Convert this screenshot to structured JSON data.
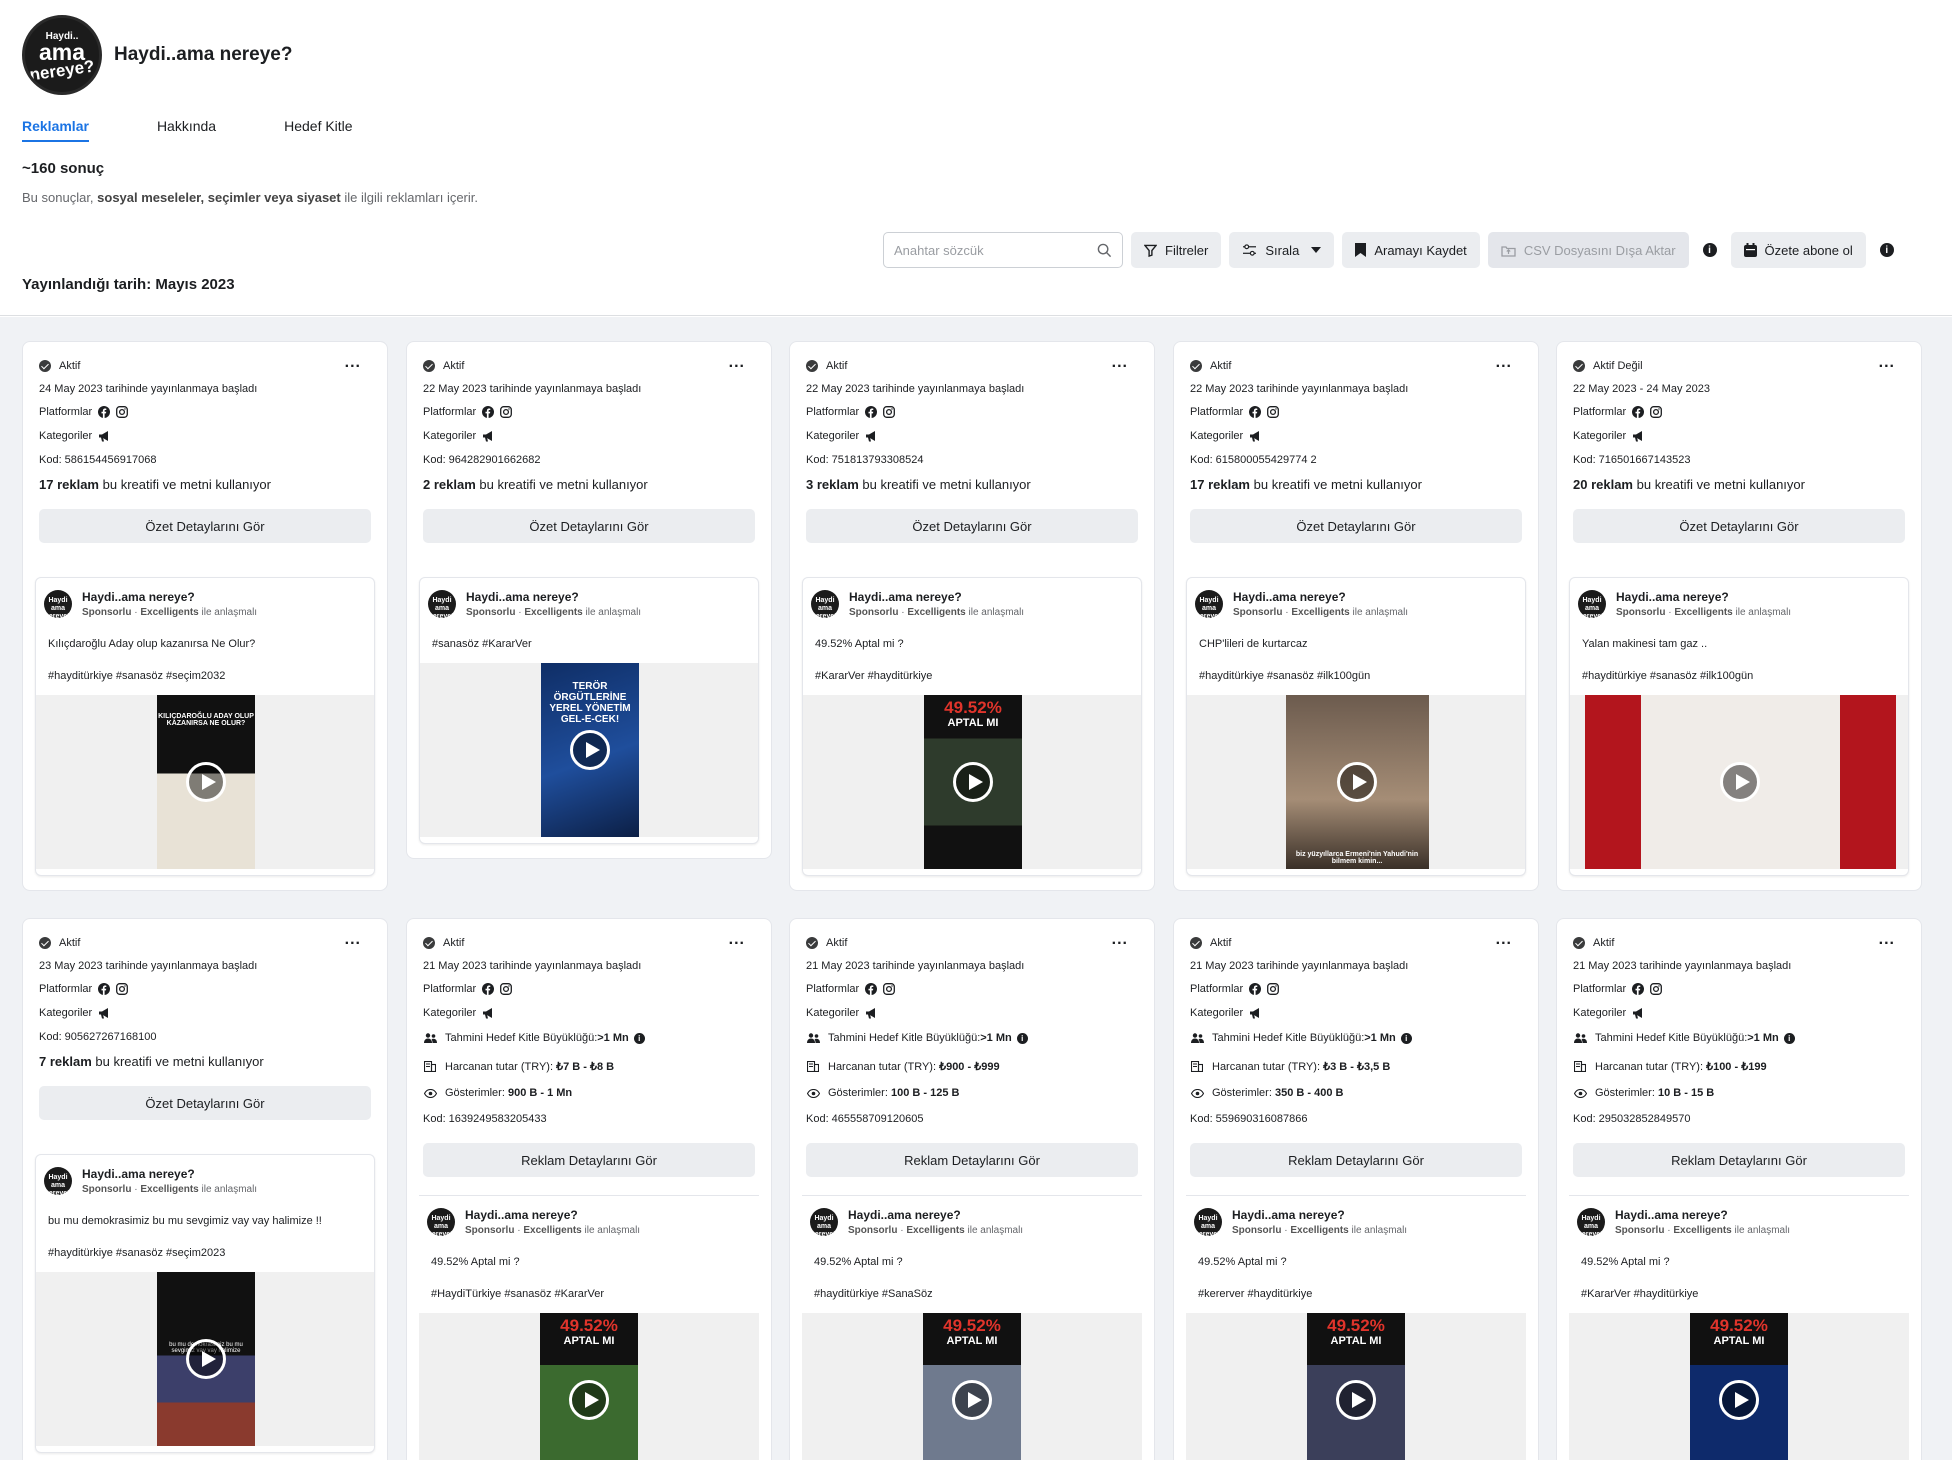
{
  "page": {
    "name": "Haydi..ama nereye?",
    "logo": {
      "l1": "Haydi..",
      "l2": "ama",
      "l3": "nereye?"
    },
    "tabs": [
      "Reklamlar",
      "Hakkında",
      "Hedef Kitle"
    ],
    "result_count": "~160 sonuç",
    "subtext_pre": "Bu sonuçlar, ",
    "subtext_bold": "sosyal meseleler, seçimler veya siyaset",
    "subtext_post": " ile ilgili reklamları içerir.",
    "pub_date": "Yayınlandığı tarih: Mayıs 2023"
  },
  "toolbar": {
    "search_placeholder": "Anahtar sözcük",
    "filters": "Filtreler",
    "sort": "Sırala",
    "save_search": "Aramayı Kaydet",
    "csv": "CSV Dosyasını Dışa Aktar",
    "subscribe": "Özete abone ol",
    "info": "i"
  },
  "labels": {
    "platforms": "Platformlar",
    "categories": "Kategoriler",
    "uses_text": "bu kreatifi ve metni kullanıyor",
    "summary_btn": "Özet Detaylarını Gör",
    "ad_details_btn": "Reklam Detaylarını Gör",
    "sponsored": "Sponsorlu",
    "sep": "·",
    "partner": "Excelligents",
    "partner_suffix": "ile anlaşmalı",
    "audience": "Tahmini Hedef Kitle Büyüklüğü:",
    "spend": "Harcanan tutar (TRY):",
    "impressions": "Gösterimler:",
    "dots": "...",
    "mini_logo": "Haydi ama nereye?"
  },
  "cards": [
    {
      "status": "Aktif",
      "date": "24 May 2023 tarihinde yayınlanmaya başladı",
      "code": "Kod: 586154456917068",
      "ad_count": "17 reklam",
      "text": "Kılıçdaroğlu Aday olup kazanırsa Ne Olur?",
      "tags": "#hayditürkiye #sanasöz #seçim2032",
      "video_text": "KILIÇDAROĞLU ADAY OLUP KAZANIRSA NE OLUR?"
    },
    {
      "status": "Aktif",
      "date": "22 May 2023 tarihinde yayınlanmaya başladı",
      "code": "Kod: 964282901662682",
      "ad_count": "2 reklam",
      "text": "#sanasöz #KararVer",
      "tags": "",
      "video_text": "TERÖR ÖRGÜTLERİNE YEREL YÖNETİM GEL-E-CEK!"
    },
    {
      "status": "Aktif",
      "date": "22 May 2023 tarihinde yayınlanmaya başladı",
      "code": "Kod: 751813793308524",
      "ad_count": "3 reklam",
      "text": "49.52% Aptal mi ?",
      "tags": "#KararVer #hayditürkiye",
      "video_text": "49.52%",
      "video_sub": "APTAL MI"
    },
    {
      "status": "Aktif",
      "date": "22 May 2023 tarihinde yayınlanmaya başladı",
      "code": "Kod: 615800055429774 2",
      "ad_count": "17 reklam",
      "text": "CHP'lileri de kurtarcaz",
      "tags": "#hayditürkiye #sanasöz #ilk100gün",
      "video_text": "biz yüzyıllarca Ermeni'nin Yahudi'nin bilmem kimin..."
    },
    {
      "status": "Aktif Değil",
      "date": "22 May 2023 - 24 May 2023",
      "code": "Kod: 716501667143523",
      "ad_count": "20 reklam",
      "text": "Yalan makinesi tam gaz ..",
      "tags": "#hayditürkiye #sanasöz #ilk100gün",
      "video_text": ""
    },
    {
      "status": "Aktif",
      "date": "23 May 2023 tarihinde yayınlanmaya başladı",
      "code": "Kod: 905627267168100",
      "ad_count": "7 reklam",
      "text": "bu mu demokrasimiz bu mu sevgimiz vay vay halimize !!",
      "tags": "#hayditürkiye #sanasöz #seçim2023",
      "video_text": "bu mu demokrasimiz bu mu sevgimiz vay vay halimize"
    },
    {
      "status": "Aktif",
      "date": "21 May 2023 tarihinde yayınlanmaya başladı",
      "audience": ">1 Mn",
      "spend": "₺7 B - ₺8 B",
      "impressions": "900 B - 1 Mn",
      "code": "Kod: 1639249583205433",
      "text": "49.52% Aptal mi ?",
      "tags": "#HaydiTürkiye #sanasöz #KararVer",
      "video_text": "49.52%",
      "video_sub": "APTAL MI"
    },
    {
      "status": "Aktif",
      "date": "21 May 2023 tarihinde yayınlanmaya başladı",
      "audience": ">1 Mn",
      "spend": "₺900 - ₺999",
      "impressions": "100 B - 125 B",
      "code": "Kod: 465558709120605",
      "text": "49.52% Aptal mi ?",
      "tags": "#hayditürkiye #SanaSöz",
      "video_text": "49.52%",
      "video_sub": "APTAL MI"
    },
    {
      "status": "Aktif",
      "date": "21 May 2023 tarihinde yayınlanmaya başladı",
      "audience": ">1 Mn",
      "spend": "₺3 B - ₺3,5 B",
      "impressions": "350 B - 400 B",
      "code": "Kod: 559690316087866",
      "text": "49.52% Aptal mi ?",
      "tags": "#kererver #hayditürkiye",
      "video_text": "49.52%",
      "video_sub": "APTAL MI"
    },
    {
      "status": "Aktif",
      "date": "21 May 2023 tarihinde yayınlanmaya başladı",
      "audience": ">1 Mn",
      "spend": "₺100 - ₺199",
      "impressions": "10 B - 15 B",
      "code": "Kod: 295032852849570",
      "text": "49.52% Aptal mi ?",
      "tags": "#KararVer #hayditürkiye",
      "video_text": "49.52%",
      "video_sub": "APTAL MI"
    }
  ]
}
